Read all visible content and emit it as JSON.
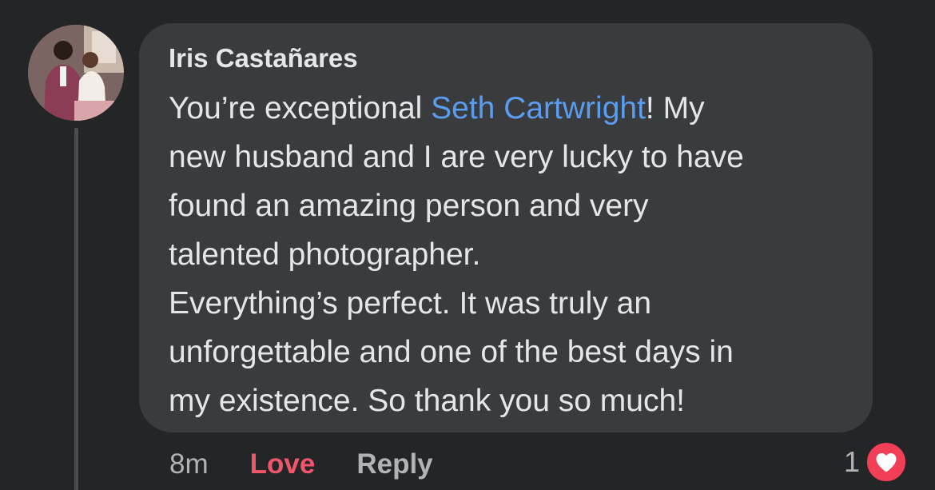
{
  "comment": {
    "author": "Iris Castañares",
    "body": {
      "line1_before": "You’re exceptional ",
      "mention": "Seth Cartwright",
      "line1_after": "! My",
      "lines": [
        "new husband and I are very lucky to have",
        "found an amazing person and very",
        "talented photographer.",
        "Everything’s perfect. It was truly an",
        "unforgettable and one of the best days in",
        "my existence. So thank you so much!"
      ]
    }
  },
  "actions": {
    "time": "8m",
    "love_label": "Love",
    "reply_label": "Reply"
  },
  "reactions": {
    "count": "1",
    "icon": "heart-icon"
  },
  "colors": {
    "background": "#242526",
    "bubble": "#3a3b3c",
    "mention": "#5a9df0",
    "love": "#f0556b",
    "heart_badge": "#f33e58"
  }
}
